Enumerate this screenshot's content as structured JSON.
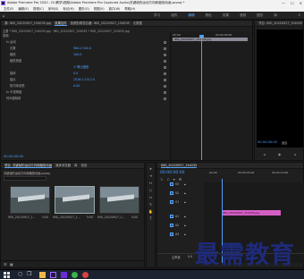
{
  "title_bar": {
    "title": "Adobe Premiere Pro 2020 - D:\\教学\\视频\\Adobe Premiere Pro Captured Audio\\关键帧的运动方向和缩放动画.prproj *",
    "minimize": "—",
    "maximize": "☐",
    "close": "✕"
  },
  "menu": [
    "文件(F)",
    "编辑(E)",
    "剪辑(C)",
    "序列(S)",
    "标记(M)",
    "图形(G)",
    "视图(V)",
    "窗口(W)",
    "帮助(H)"
  ],
  "workspace_tabs": [
    "学习",
    "组件",
    "编辑",
    "颜色",
    "效果",
    "音频",
    "图形",
    "库"
  ],
  "workspace_active": "编辑",
  "source_panel": {
    "tabs": [
      "源: IMG_20220927_154035.jpg",
      "效果控件",
      "音频剪辑混合器: IMG_20220927_154035",
      "元数据"
    ],
    "active": "效果控件",
    "clip_line": "主要 * IMG_20220927_154035.jpg  ·  IMG_20220927_154035 * IMG_20220927_154035.jpg",
    "timecode_ruler": [
      "00:00",
      "00:00:05:00"
    ],
    "clip_name": "IMG_20220927_154035.jpg",
    "effects": [
      {
        "label": "视频",
        "indent": 0
      },
      {
        "label": "fx  运动",
        "indent": 1
      },
      {
        "label": "位置",
        "indent": 2,
        "value": "960.0    540.0"
      },
      {
        "label": "缩放",
        "indent": 2,
        "value": "100.0"
      },
      {
        "label": "缩放宽度",
        "indent": 2,
        "value": ""
      },
      {
        "label": "",
        "indent": 2,
        "value": "☑ 等比缩放"
      },
      {
        "label": "旋转",
        "indent": 2,
        "value": "0.0"
      },
      {
        "label": "锚点",
        "indent": 2,
        "value": "2016.0   1512.0"
      },
      {
        "label": "防闪烁滤镜",
        "indent": 2,
        "value": "0.00"
      },
      {
        "label": "fx  不透明度",
        "indent": 1
      },
      {
        "label": "时间重映射",
        "indent": 1
      }
    ],
    "bottom_timecode": "00:00:00:00"
  },
  "program_panel": {
    "title": "节目: IMG_20220927_154035",
    "timecode": "00:00:00:00",
    "fit": "适合"
  },
  "project_panel": {
    "tabs": [
      "项目: 关键帧的运动方向和缩放动画",
      "媒体浏览器",
      "库",
      "信息"
    ],
    "active": "项目: 关键帧的运动方向和缩放动画",
    "file": "关键帧的运动方向和缩放动画.prproj",
    "items": [
      {
        "name": "IMG_20220927_1...",
        "duration": "5:00"
      },
      {
        "name": "IMG_20220927_1...",
        "duration": "5:00"
      },
      {
        "name": "IMG_20220927_1...",
        "duration": "5:00"
      }
    ]
  },
  "timeline_panel": {
    "tab": "IMG_20220927_154035",
    "timecode": "00:00:00:00",
    "ruler": [
      "00:00",
      "00:00:05:00",
      "00:00:10:00"
    ],
    "video_tracks": [
      "V3",
      "V2",
      "V1"
    ],
    "audio_tracks": [
      "A1",
      "A2",
      "A3"
    ],
    "master": "主声道",
    "master_value": "0.0",
    "clip_label": "IMG_20220927_154035.jpg"
  },
  "taskbar": {
    "search_placeholder": "在这里输入你要搜索的内容"
  },
  "watermark": "最需教育",
  "colors": {
    "accent": "#5aa7ff",
    "clip_pink": "#d35fc4",
    "playhead": "#4d9fff"
  }
}
